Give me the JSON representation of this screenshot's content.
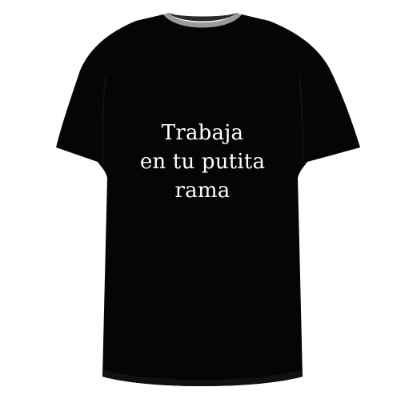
{
  "product": {
    "print_lines": [
      "Trabaja",
      "en tu putita",
      "rama"
    ],
    "colors": {
      "background": "#ffffff",
      "shirt": "#050505",
      "collar_band": "#9a9a9a",
      "print_text": "#ffffff"
    }
  }
}
